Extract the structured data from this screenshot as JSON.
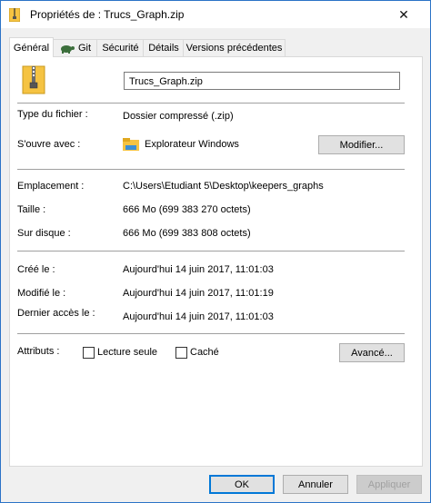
{
  "window": {
    "title": "Propriétés de : Trucs_Graph.zip",
    "close_glyph": "✕"
  },
  "tabs": [
    {
      "label": "Général",
      "active": true
    },
    {
      "label": "Git",
      "active": false
    },
    {
      "label": "Sécurité",
      "active": false
    },
    {
      "label": "Détails",
      "active": false
    },
    {
      "label": "Versions précédentes",
      "active": false
    }
  ],
  "general": {
    "file_name": "Trucs_Graph.zip",
    "type_label": "Type du fichier :",
    "type_value": "Dossier compressé (.zip)",
    "opens_with_label": "S'ouvre avec :",
    "opens_with_value": "Explorateur Windows",
    "modify_button": "Modifier...",
    "location_label": "Emplacement :",
    "location_value": "C:\\Users\\Etudiant 5\\Desktop\\keepers_graphs",
    "size_label": "Taille :",
    "size_value": "666 Mo (699 383 270 octets)",
    "disk_size_label": "Sur disque :",
    "disk_size_value": "666 Mo (699 383 808 octets)",
    "created_label": "Créé le :",
    "created_value": "Aujourd'hui 14 juin 2017, 11:01:03",
    "modified_label": "Modifié le :",
    "modified_value": "Aujourd'hui 14 juin 2017, 11:01:19",
    "accessed_label": "Dernier accès le :",
    "accessed_value": "Aujourd'hui 14 juin 2017, 11:01:03",
    "attributes_label": "Attributs :",
    "readonly_label": "Lecture seule",
    "readonly_checked": false,
    "hidden_label": "Caché",
    "hidden_checked": false,
    "advanced_button": "Avancé..."
  },
  "footer": {
    "ok": "OK",
    "cancel": "Annuler",
    "apply": "Appliquer"
  },
  "colors": {
    "accent": "#0078d7",
    "folder_yellow": "#f5c342",
    "window_border": "#2b73c7"
  }
}
